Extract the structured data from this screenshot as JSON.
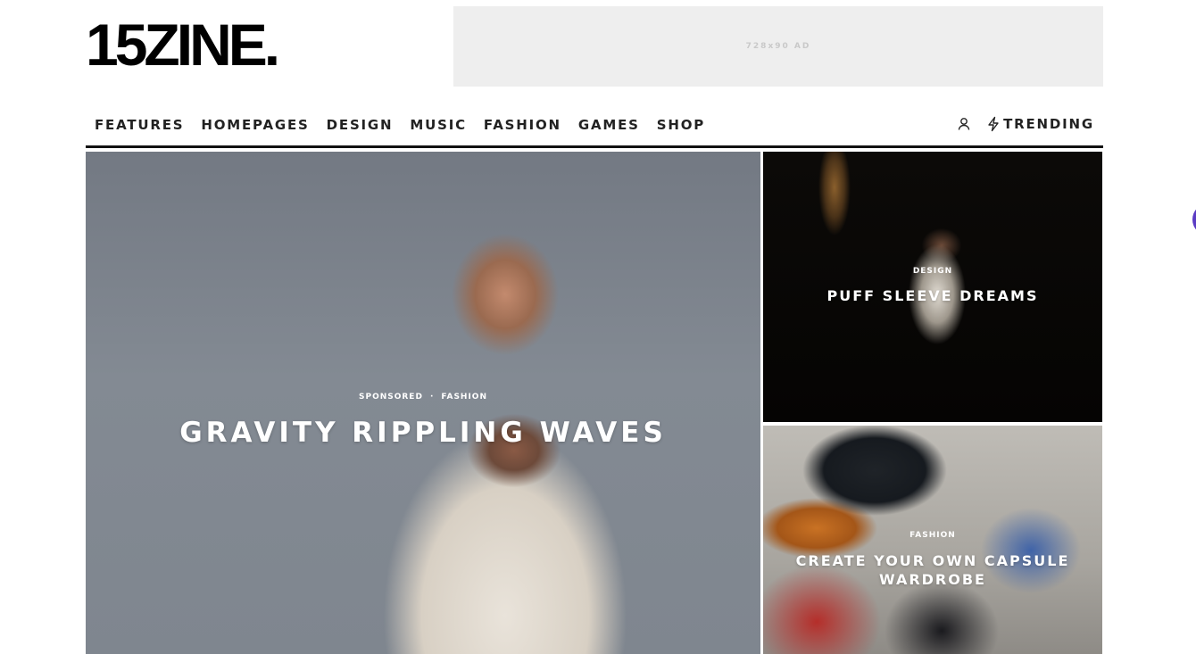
{
  "site": {
    "logo": "15ZINE."
  },
  "ad": {
    "label": "728x90 AD"
  },
  "nav": {
    "items": [
      {
        "label": "FEATURES"
      },
      {
        "label": "HOMEPAGES"
      },
      {
        "label": "DESIGN"
      },
      {
        "label": "MUSIC"
      },
      {
        "label": "FASHION"
      },
      {
        "label": "GAMES"
      },
      {
        "label": "SHOP"
      }
    ],
    "user_icon": "user-icon",
    "trending_icon": "bolt-icon",
    "trending_label": "TRENDING"
  },
  "posts": {
    "hero": {
      "meta_1": "SPONSORED",
      "meta_sep": "·",
      "meta_2": "FASHION",
      "title": "GRAVITY RIPPLING WAVES"
    },
    "side_top": {
      "category": "DESIGN",
      "title": "PUFF SLEEVE DREAMS"
    },
    "side_bottom": {
      "category": "FASHION",
      "title": "CREATE YOUR OWN CAPSULE WARDROBE"
    }
  },
  "colors": {
    "accent": "#111111",
    "ad_bg": "#eeeeee",
    "float_button": "#5b3cc4"
  }
}
